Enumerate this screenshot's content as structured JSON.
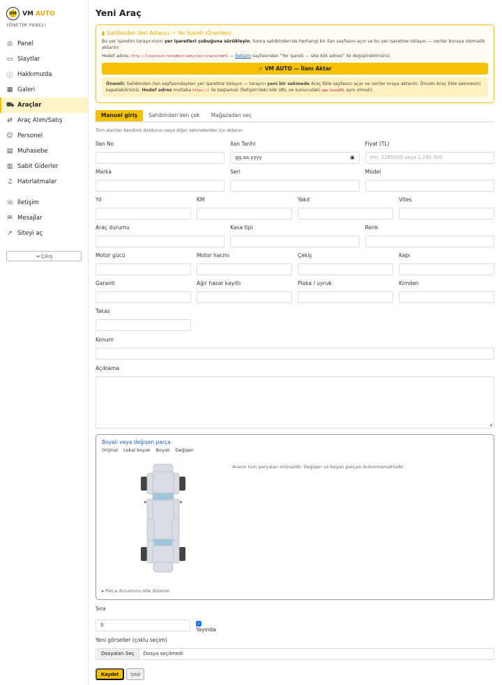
{
  "brand": {
    "vm": "VM",
    "auto": "AUTO",
    "logo_letter": "VM",
    "subtitle": "YÖNETİM PANELİ"
  },
  "sidebar": {
    "items": [
      {
        "label": "Panel",
        "icon": "dashboard-icon"
      },
      {
        "label": "Slaytlar",
        "icon": "slides-icon"
      },
      {
        "label": "Hakkımızda",
        "icon": "info-icon"
      },
      {
        "label": "Galeri",
        "icon": "gallery-icon"
      },
      {
        "label": "Araçlar",
        "icon": "car-icon",
        "active": true
      },
      {
        "label": "Araç Alım/Satış",
        "icon": "exchange-icon"
      },
      {
        "label": "Personel",
        "icon": "users-icon"
      },
      {
        "label": "Muhasebe",
        "icon": "ledger-icon"
      },
      {
        "label": "Sabit Giderler",
        "icon": "expenses-icon"
      },
      {
        "label": "Hatırlatmalar",
        "icon": "bell-icon"
      },
      {
        "label": "İletişim",
        "icon": "phone-icon"
      },
      {
        "label": "Mesajlar",
        "icon": "mail-icon"
      },
      {
        "label": "Siteyi aç",
        "icon": "external-link-icon"
      }
    ],
    "logout": "Çıkış"
  },
  "page": {
    "title": "Yeni Araç"
  },
  "notice": {
    "title": "Sahibinden Veri Aktarıcı — Yer İşareti (Önerilen)",
    "line1_a": "Bu yer işaretini tarayıcınızın ",
    "line1_b": "yer işaretleri çubuğuna sürükleyin",
    "line1_c": ". Sonra sahibinden'de herhangi bir ilan sayfasını açın ve bu yer işaretine tıklayın — veriler buraya otomatik aktarılır.",
    "line2_a": "Hedef adres: ",
    "line2_code": "http://localhost/vm/admin/vehicles/create?dm=1",
    "line2_b": " — ",
    "line2_link": "İletişim",
    "line2_c": " sayfasından \"Yer işareti — site kök adresi\" ile değiştirebilirsiniz.",
    "button": "VM AUTO — İlanı Aktar",
    "onemli_label": "Önemli:",
    "onemli_a": " Sahibinden ilan sayfasındayken yer işaretine tıklayın — tarayıcı ",
    "onemli_b": "yeni bir sekmede",
    "onemli_c": " Araç Ekle sayfasını açar ve veriler oraya aktarılır. Önceki Araç Ekle sekmesini kapatabilirsiniz. ",
    "onemli_d": "Hedef adres",
    "onemli_e": " mutlaka ",
    "onemli_code1": "https://",
    "onemli_f": " ile başlamalı (İletişim'deki kök URL ve sunucudaki ",
    "onemli_code2": "app.baseURL",
    "onemli_g": " aynı olmalı)."
  },
  "tabs": [
    {
      "label": "Manuel giriş",
      "active": true
    },
    {
      "label": "Sahibinden'den çek"
    },
    {
      "label": "Mağazadan seç"
    }
  ],
  "hint": "Tüm alanları kendiniz doldurun veya diğer sekmelerden içe aktarın.",
  "fields": {
    "ilan_no": "İlan No",
    "ilan_tarihi": "İlan Tarihi",
    "ilan_tarihi_value": "gg.aa.yyyy",
    "fiyat": "Fiyat (TL)",
    "fiyat_placeholder": "örn. 1295000 veya 1.295.000",
    "marka": "Marka",
    "seri": "Seri",
    "model": "Model",
    "yil": "Yıl",
    "km": "KM",
    "yakit": "Yakıt",
    "vites": "Vites",
    "arac_durumu": "Araç durumu",
    "kasa_tipi": "Kasa tipi",
    "renk": "Renk",
    "motor_gucu": "Motor gücü",
    "motor_hacmi": "Motor hacmi",
    "cekis": "Çekiş",
    "kapi": "Kapı",
    "garanti": "Garanti",
    "agir_hasar": "Ağır hasar kayıtlı",
    "plaka": "Plaka / uyruk",
    "kimden": "Kimden",
    "takas": "Takas",
    "konum": "Konum",
    "aciklama": "Açıklama"
  },
  "parts": {
    "title": "Boyalı veya değişen parça",
    "legend": [
      "Orijinal",
      "Lokal boyalı",
      "Boyalı",
      "Değişen"
    ],
    "message": "Aracın tüm parçaları orijinaldir. Değişen ve boyalı parçası bulunmamaktadır.",
    "footer": "▸ Parça durumunu elle düzenle"
  },
  "sira": {
    "label": "Sıra",
    "value": "0",
    "yayinda": "Yayında",
    "yayinda_checked": true
  },
  "images": {
    "label": "Yeni görseller (çoklu seçim)",
    "button": "Dosyaları Seç",
    "status": "Dosya seçilmedi"
  },
  "actions": {
    "save": "Kaydet",
    "cancel": "İptal"
  },
  "colors": {
    "accent": "#f5c000",
    "link": "#1a5fb4",
    "car_part": "#d8dce4",
    "glass": "#9fc7dc"
  }
}
